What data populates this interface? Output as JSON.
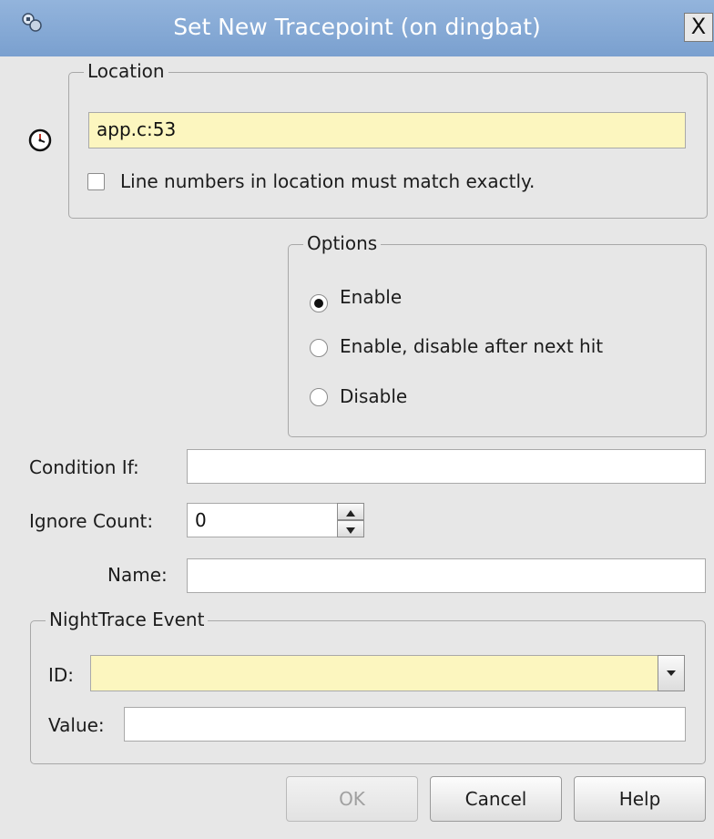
{
  "window": {
    "title": "Set New Tracepoint (on dingbat)",
    "close_glyph": "X"
  },
  "location": {
    "legend": "Location",
    "value": "app.c:53",
    "exact_match_label": "Line numbers in location must match exactly.",
    "exact_match_checked": false,
    "icon": "tracepoint-clock-icon"
  },
  "options": {
    "legend": "Options",
    "radios": [
      {
        "label": "Enable",
        "selected": true
      },
      {
        "label": "Enable, disable after next hit",
        "selected": false
      },
      {
        "label": "Disable",
        "selected": false
      }
    ]
  },
  "condition": {
    "label": "Condition If:",
    "value": ""
  },
  "ignore_count": {
    "label": "Ignore Count:",
    "value": "0"
  },
  "name": {
    "label": "Name:",
    "value": ""
  },
  "nighttrace": {
    "legend": "NightTrace Event",
    "id_label": "ID:",
    "id_value": "",
    "value_label": "Value:",
    "value_value": ""
  },
  "buttons": {
    "ok": "OK",
    "cancel": "Cancel",
    "help": "Help"
  },
  "colors": {
    "title_bar": "#7aa0cf",
    "field_highlight": "#fcf6bf",
    "dialog_bg": "#e7e7e7"
  }
}
